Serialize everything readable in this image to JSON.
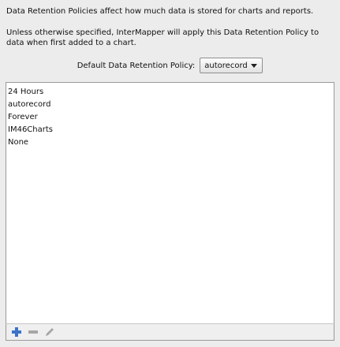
{
  "intro": {
    "line1": "Data Retention Policies affect how much data is stored for charts and reports.",
    "line2": "Unless otherwise specified, InterMapper will apply this Data Retention Policy to data when first added to a chart."
  },
  "default_policy": {
    "label": "Default Data Retention Policy:",
    "selected": "autorecord"
  },
  "policies": [
    "24 Hours",
    "autorecord",
    "Forever",
    "IM46Charts",
    "None"
  ],
  "toolbar": {
    "add_icon": "plus-icon",
    "remove_icon": "minus-icon",
    "edit_icon": "pencil-icon"
  },
  "colors": {
    "add_icon": "#3b73c8",
    "disabled_icon": "#a6a6a6"
  }
}
